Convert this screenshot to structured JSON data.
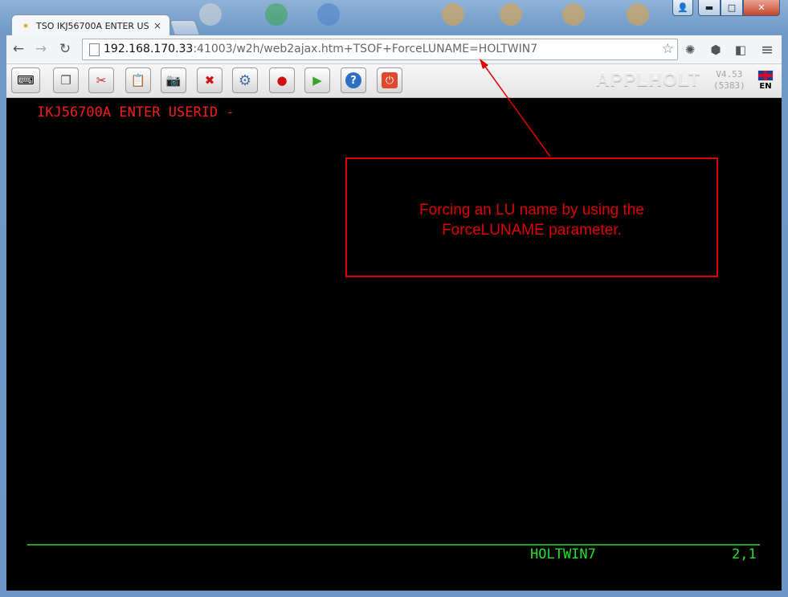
{
  "tab": {
    "title": "TSO IKJ56700A ENTER USERID -",
    "close_glyph": "×"
  },
  "window_controls": {
    "minimize": "▬",
    "maximize": "□",
    "close": "✕"
  },
  "nav": {
    "back_glyph": "←",
    "forward_glyph": "→",
    "reload_glyph": "↻",
    "url_host": "192.168.170.33",
    "url_rest": ":41003/w2h/web2ajax.htm+TSOF+ForceLUNAME=HOLTWIN7",
    "star_glyph": "☆",
    "menu_glyph": "≡"
  },
  "toolbar": {
    "brand": "APPLHOLT",
    "version": "V4.53",
    "build": "(5383)",
    "language": "EN",
    "buttons": [
      {
        "icon": "keyboard-icon",
        "glyph": "⌨"
      },
      {
        "icon": "copy-icon",
        "glyph": "❐"
      },
      {
        "icon": "cut-icon",
        "glyph": "✂"
      },
      {
        "icon": "paste-icon",
        "glyph": "📋"
      },
      {
        "icon": "screenshot-icon",
        "glyph": "📷"
      },
      {
        "icon": "disconnect-icon",
        "glyph": "✖"
      },
      {
        "icon": "settings-icon",
        "glyph": "⚙"
      },
      {
        "icon": "record-icon",
        "glyph": "●"
      },
      {
        "icon": "play-icon",
        "glyph": "▶"
      },
      {
        "icon": "help-icon",
        "glyph": "?"
      },
      {
        "icon": "power-icon",
        "glyph": "⏻"
      }
    ]
  },
  "terminal": {
    "prompt": "IKJ56700A ENTER USERID -",
    "lu_name": "HOLTWIN7",
    "cursor_position": "2,1"
  },
  "annotation": {
    "line1": "Forcing an LU name by using the",
    "line2": "ForceLUNAME parameter."
  },
  "colors": {
    "terminal_bg": "#000000",
    "prompt_red": "#f21c1c",
    "oia_green": "#26e126",
    "annotation_red": "#e00000"
  }
}
